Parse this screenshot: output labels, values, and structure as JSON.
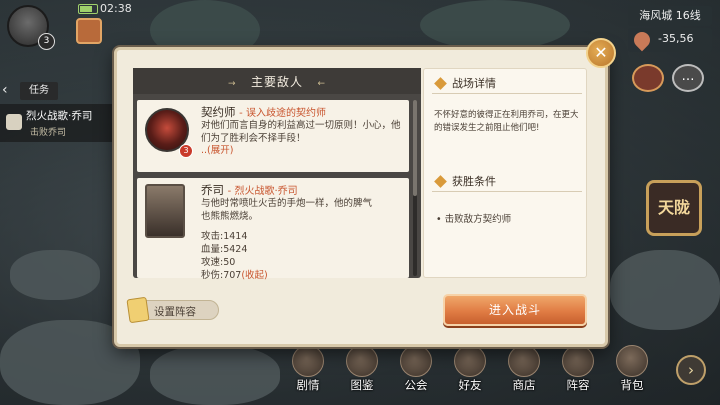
{
  "hud": {
    "avatar_level": "3",
    "clock": "02:38",
    "server": "海风城 16线",
    "coords": "-35,56"
  },
  "task_tracker": {
    "tab_label": "任务",
    "arrow": "‹",
    "entry_title": "烈火战歌·乔司",
    "entry_sub": "击败乔司"
  },
  "right_icons": {
    "chat": "…",
    "skyfall_label": "天陇"
  },
  "bottom_nav": [
    {
      "label": "剧情"
    },
    {
      "label": "图鉴"
    },
    {
      "label": "公会"
    },
    {
      "label": "好友"
    },
    {
      "label": "商店"
    },
    {
      "label": "阵容"
    },
    {
      "label": "背包"
    }
  ],
  "bottom_more": "›",
  "modal": {
    "close": "✕",
    "enemies_header": "主要敌人",
    "header_arrow_left": "→",
    "header_arrow_right": "←",
    "enemy1": {
      "name": "契约师",
      "tag": "- 误入歧途的契约师",
      "level": "3",
      "desc": "对他们而言自身的利益高过一切原则！小心，他们为了胜利会不择手段！",
      "expand": "..(展开)"
    },
    "enemy2": {
      "name": "乔司",
      "tag": "- 烈火战歌·乔司",
      "desc": "与他时常喷吐火舌的手炮一样，他的脾气也熊熊燃烧。",
      "stats": [
        "攻击:1414",
        "血量:5424",
        "攻速:50"
      ],
      "last_stat": "秒伤:707",
      "collapse": "(收起)"
    },
    "battle_title": "战场详情",
    "battle_text_1": "不怀好意的彼得正在利用乔司，在更大",
    "battle_text_2": "的错误发生之前阻止他们吧!",
    "victory_title": "获胜条件",
    "victory_item": "• 击败敌方契约师",
    "formation_label": "设置阵容",
    "fight_label": "进入战斗"
  }
}
